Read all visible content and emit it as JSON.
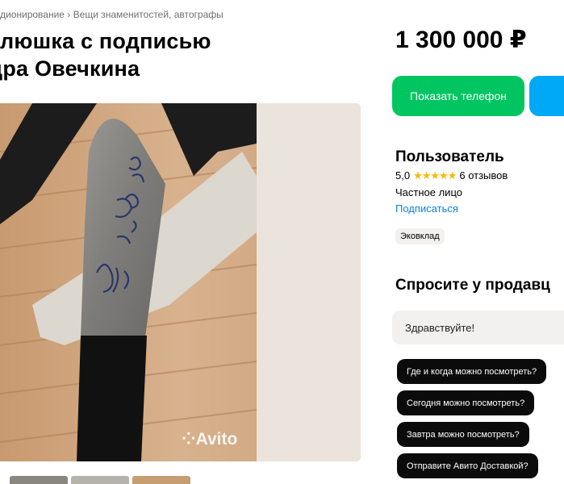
{
  "breadcrumb": "дионирование › Вещи знаменитостей, автографы",
  "listing": {
    "title_line1": "клюшка с подписью",
    "title_line2": "дра Овечкина",
    "price": "1 300 000 ₽"
  },
  "actions": {
    "phone_label": "Показать телефон"
  },
  "seller": {
    "name": "Пользователь",
    "rating": "5,0",
    "stars": "★★★★★",
    "reviews": "6 отзывов",
    "type": "Частное лицо",
    "subscribe_label": "Подписаться",
    "badge": "Эковклад"
  },
  "ask": {
    "title": "Спросите у продавц",
    "input_value": "Здравствуйте!",
    "questions": [
      "Где и когда можно посмотреть?",
      "Сегодня можно посмотреть?",
      "Завтра можно посмотреть?",
      "Отправите Авито Доставкой?"
    ]
  },
  "photo": {
    "watermark": "Avito"
  },
  "colors": {
    "green": "#00c560",
    "blue": "#00a9f5",
    "link": "#0a84dd",
    "star": "#ffb800"
  }
}
